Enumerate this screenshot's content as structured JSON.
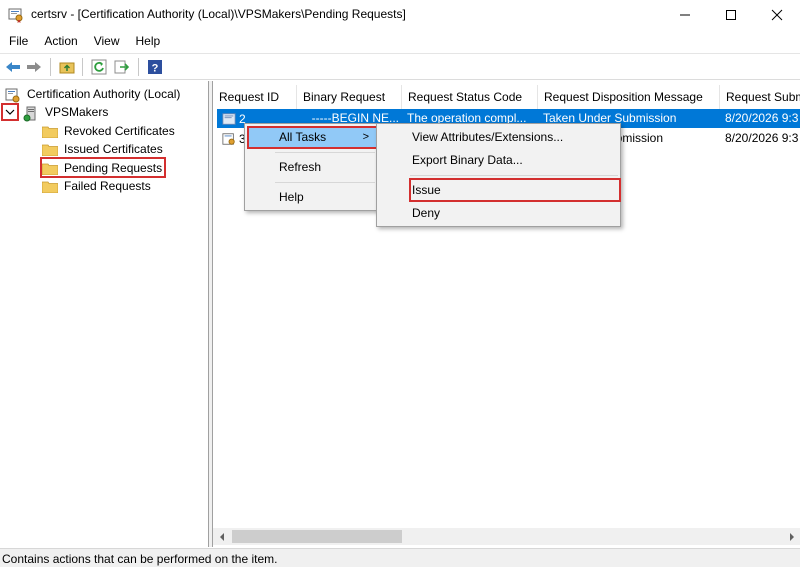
{
  "window": {
    "title": "certsrv - [Certification Authority (Local)\\VPSMakers\\Pending Requests]",
    "controls": [
      "minimize-icon",
      "maximize-icon",
      "close-icon"
    ]
  },
  "menubar": {
    "items": [
      "File",
      "Action",
      "View",
      "Help"
    ]
  },
  "toolbar": {
    "icons": [
      "back-arrow-icon",
      "forward-arrow-icon",
      "up-folder-icon",
      "refresh-icon",
      "export-list-icon",
      "help-icon"
    ]
  },
  "tree": {
    "root": "Certification Authority (Local)",
    "ca": "VPSMakers",
    "folders": [
      "Revoked Certificates",
      "Issued Certificates",
      "Pending Requests",
      "Failed Requests"
    ],
    "selected": "Pending Requests"
  },
  "list": {
    "columns": [
      "Request ID",
      "Binary Request",
      "Request Status Code",
      "Request Disposition Message",
      "Request Subm"
    ],
    "rows": [
      {
        "id": "2",
        "binary": "-----BEGIN NE...",
        "status": "The operation compl...",
        "disposition": "Taken Under Submission",
        "submitted": "8/20/2026 9:3"
      },
      {
        "id": "3",
        "binary": "",
        "status": "",
        "disposition": "ubmission",
        "submitted": "8/20/2026 9:3"
      }
    ]
  },
  "context_menu": {
    "items": [
      "All Tasks",
      "Refresh",
      "Help"
    ],
    "submenu_arrow": ">"
  },
  "submenu": {
    "items": [
      "View Attributes/Extensions...",
      "Export Binary Data...",
      "Issue",
      "Deny"
    ]
  },
  "statusbar": {
    "text": "Contains actions that can be performed on the item."
  },
  "colors": {
    "selection": "#0078d7",
    "menu_hover": "#91c9f7",
    "annotation_red": "#d32f2f"
  }
}
